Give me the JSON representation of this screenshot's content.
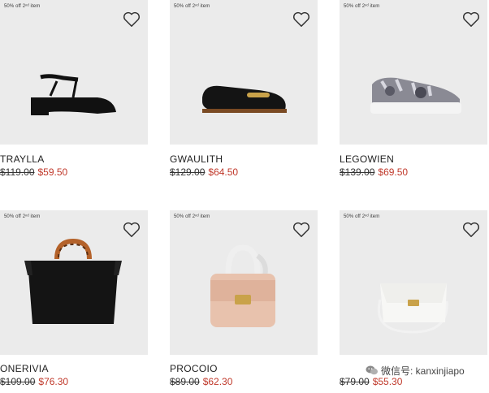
{
  "products": [
    {
      "promo": "50% off 2ⁿᵈ item",
      "name": "TRAYLLA",
      "old_price": "$119.00",
      "new_price": "$59.50",
      "icon": "sandal-icon"
    },
    {
      "promo": "50% off 2ⁿᵈ item",
      "name": "GWAULITH",
      "old_price": "$129.00",
      "new_price": "$64.50",
      "icon": "loafer-icon"
    },
    {
      "promo": "50% off 2ⁿᵈ item",
      "name": "LEGOWIEN",
      "old_price": "$139.00",
      "new_price": "$69.50",
      "icon": "sneaker-icon"
    },
    {
      "promo": "50% off 2ⁿᵈ item",
      "name": "ONERIVIA",
      "old_price": "$109.00",
      "new_price": "$76.30",
      "icon": "tote-bag-icon"
    },
    {
      "promo": "50% off 2ⁿᵈ item",
      "name": "PROCOIO",
      "old_price": "$89.00",
      "new_price": "$62.30",
      "icon": "handbag-icon"
    },
    {
      "promo": "50% off 2ⁿᵈ item",
      "name": "",
      "old_price": "$79.00",
      "new_price": "$55.30",
      "icon": "crossbody-bag-icon"
    }
  ],
  "watermark": {
    "text": "微信号: kanxinjiapo",
    "icon": "wechat-icon"
  },
  "colors": {
    "card_bg": "#ebebeb",
    "sale_price": "#c0392b",
    "text": "#222222"
  }
}
